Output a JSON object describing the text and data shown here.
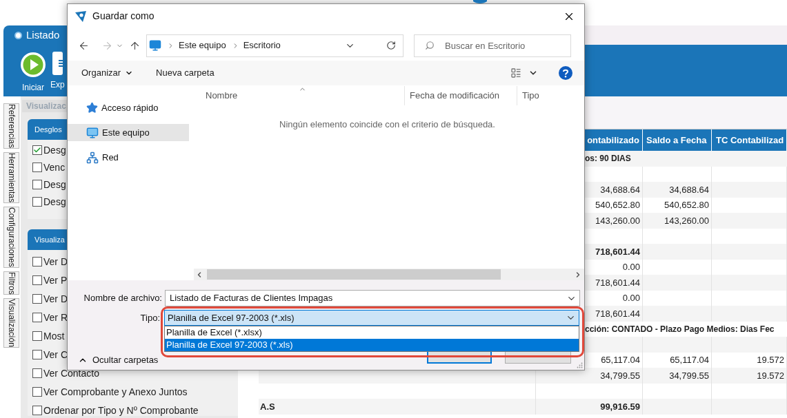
{
  "app": {
    "title": "Listado",
    "toolbar": [
      {
        "label": "Iniciar",
        "kind": "play"
      },
      {
        "label": "Exp",
        "kind": "list"
      }
    ],
    "side_tabs": [
      "Referencias",
      "Herramientas",
      "Configuraciones",
      "Filtros",
      "Visualización"
    ],
    "panel": {
      "title": "Visualizac",
      "groups": [
        {
          "title": "Desglos",
          "options": [
            {
              "label": "Desg",
              "checked": true
            },
            {
              "label": "Venc",
              "checked": false
            },
            {
              "label": "Desg",
              "checked": false
            },
            {
              "label": "Desg",
              "checked": false
            }
          ]
        },
        {
          "title": "Visualiza",
          "options": [
            {
              "label": "Ver D",
              "checked": false
            },
            {
              "label": "Ver P",
              "checked": false
            },
            {
              "label": "Ver D",
              "checked": false
            },
            {
              "label": "Ver R",
              "checked": false
            },
            {
              "label": "Most",
              "checked": false
            },
            {
              "label": "Ver C",
              "checked": false
            },
            {
              "label": "Ver Contacto",
              "checked": false
            },
            {
              "label": "Ver Comprobante y Anexo Juntos",
              "checked": false
            },
            {
              "label": "Ordenar por Tipo y Nº Comprobante",
              "checked": false
            }
          ]
        }
      ]
    },
    "table": {
      "columns": [
        "ontabilizado",
        "Saldo a Fecha",
        "TC Contabilizad"
      ],
      "rows": [
        {
          "kind": "group",
          "text": "os: 90 DIAS"
        },
        {
          "kind": "blank"
        },
        {
          "kind": "data",
          "cells": [
            "34,688.64",
            "34,688.64"
          ]
        },
        {
          "kind": "data",
          "cells": [
            "540,652.80",
            "540,652.80"
          ]
        },
        {
          "kind": "data",
          "cells": [
            "143,260.00",
            "143,260.00"
          ]
        },
        {
          "kind": "blank"
        },
        {
          "kind": "total",
          "cells": [
            "718,601.44"
          ]
        },
        {
          "kind": "data",
          "cells": [
            "0.00"
          ]
        },
        {
          "kind": "data",
          "cells": [
            "718,601.44"
          ]
        },
        {
          "kind": "data",
          "cells": [
            "0.00"
          ]
        },
        {
          "kind": "data",
          "cells": [
            "718,601.44"
          ]
        },
        {
          "kind": "group",
          "text": "cción: CONTADO - Plazo Pago Medios: Dias Fec"
        },
        {
          "kind": "blank"
        },
        {
          "kind": "data",
          "cells": [
            "65,117.04",
            "65,117.04",
            "19.572"
          ]
        },
        {
          "kind": "data",
          "cells": [
            "34,799.55",
            "34,799.55",
            "19.572"
          ]
        },
        {
          "kind": "blank"
        },
        {
          "kind": "total",
          "label": "A.S",
          "cells": [
            "99,916.59"
          ]
        }
      ]
    }
  },
  "dialog": {
    "title": "Guardar como",
    "path": [
      "Este equipo",
      "Escritorio"
    ],
    "search": {
      "placeholder": "Buscar en Escritorio"
    },
    "toolbar": {
      "organize": "Organizar",
      "new_folder": "Nueva carpeta"
    },
    "nav": [
      {
        "label": "Acceso rápido",
        "kind": "star",
        "selected": false
      },
      {
        "label": "Este equipo",
        "kind": "pc",
        "selected": true
      },
      {
        "label": "Red",
        "kind": "network",
        "selected": false
      }
    ],
    "columns": [
      "Nombre",
      "Fecha de modificación",
      "Tipo"
    ],
    "empty_message": "Ningún elemento coincide con el criterio de búsqueda.",
    "filename": {
      "label": "Nombre de archivo:",
      "value": "Listado de Facturas de Clientes Impagas"
    },
    "type": {
      "label": "Tipo:",
      "value": "Planilla de Excel 97-2003 (*.xls)",
      "expanded": true,
      "options": [
        {
          "label": "Planilla de Excel (*.xlsx)",
          "selected": false
        },
        {
          "label": "Planilla de Excel 97-2003 (*.xls)",
          "selected": true
        }
      ]
    },
    "hide_folders": "Ocultar carpetas"
  }
}
